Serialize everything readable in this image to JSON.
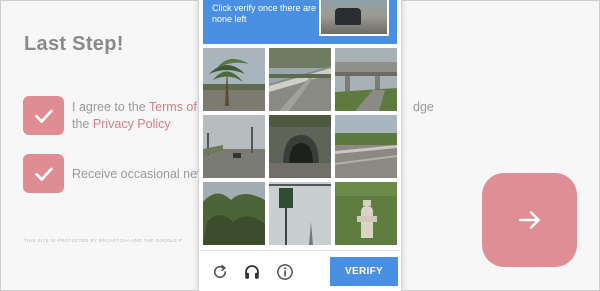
{
  "page": {
    "title": "Last Step!",
    "consent_1": {
      "prefix": "I agree to the ",
      "terms_link": "Terms of",
      "suffix_hidden": "dge",
      "second_line": "the ",
      "privacy_link": "Privacy Policy"
    },
    "consent_2": {
      "text": "Receive occasional new"
    },
    "fine_print": "THIS SITE IS PROTECTED BY RECAPTCHA AND THE GOOGLE P",
    "colors": {
      "accent": "#e08c93",
      "text": "#8a8a8a",
      "link": "#d0808a"
    }
  },
  "captcha": {
    "instruction": "Click verify once there are none left",
    "verify_label": "VERIFY",
    "header_color": "#4a90e2",
    "icons": [
      "reload-icon",
      "audio-icon",
      "info-icon"
    ]
  }
}
